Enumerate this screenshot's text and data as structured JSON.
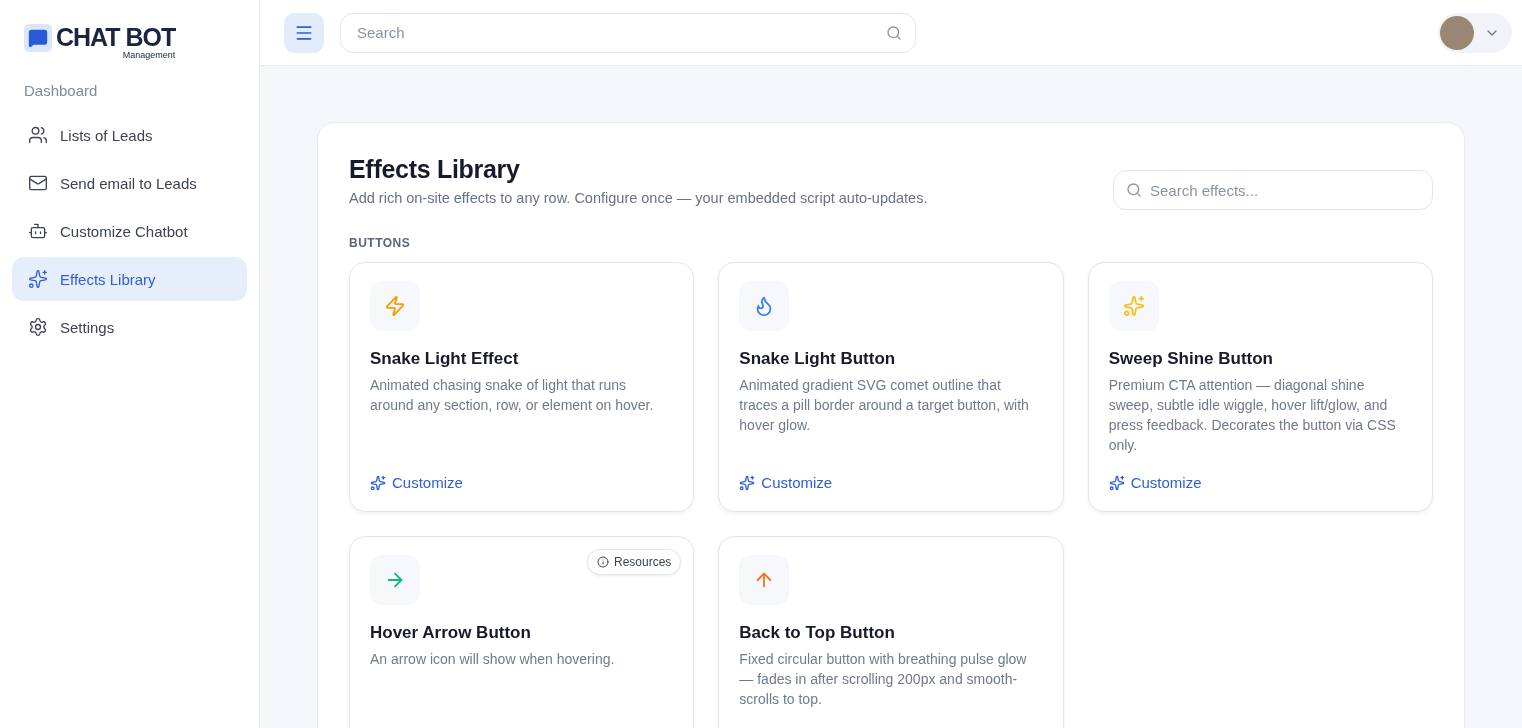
{
  "brand": {
    "name": "CHAT BOT",
    "tagline": "Management"
  },
  "sidebar": {
    "section": "Dashboard",
    "items": [
      {
        "label": "Lists of Leads",
        "selected": false
      },
      {
        "label": "Send email to Leads",
        "selected": false
      },
      {
        "label": "Customize Chatbot",
        "selected": false
      },
      {
        "label": "Effects Library",
        "selected": true
      },
      {
        "label": "Settings",
        "selected": false
      }
    ]
  },
  "topbar": {
    "search_placeholder": "Search"
  },
  "page": {
    "title": "Effects Library",
    "subtitle": "Add rich on-site effects to any row. Configure once — your embedded script auto-updates.",
    "search_placeholder": "Search effects...",
    "section": "BUTTONS"
  },
  "cards": [
    {
      "title": "Snake Light Effect",
      "description": "Animated chasing snake of light that runs around any section, row, or element on hover.",
      "color": "#f59e0b",
      "action": "Customize"
    },
    {
      "title": "Snake Light Button",
      "description": "Animated gradient SVG comet outline that traces a pill border around a target button, with hover glow.",
      "color": "#3b82f6",
      "action": "Customize"
    },
    {
      "title": "Sweep Shine Button",
      "description": "Premium CTA attention — diagonal shine sweep, subtle idle wiggle, hover lift/glow, and press feedback. Decorates the button via CSS only.",
      "color": "#fbbf24",
      "action": "Customize"
    },
    {
      "title": "Hover Arrow Button",
      "description": "An arrow icon will show when hovering.",
      "color": "#10b981",
      "badge": "Resources"
    },
    {
      "title": "Back to Top Button",
      "description": "Fixed circular button with breathing pulse glow — fades in after scrolling 200px and smooth-scrolls to top.",
      "color": "#f97316"
    }
  ]
}
